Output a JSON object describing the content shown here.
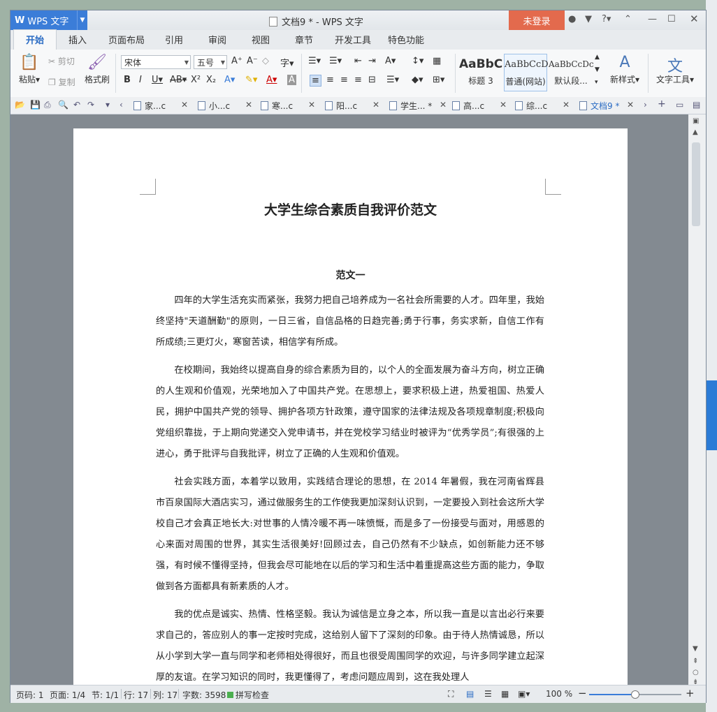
{
  "app": {
    "badge_logo": "W",
    "badge_name": "WPS 文字",
    "window_title": "文档9 * - WPS 文字",
    "login_label": "未登录"
  },
  "menu": {
    "tabs": [
      "开始",
      "插入",
      "页面布局",
      "引用",
      "审阅",
      "视图",
      "章节",
      "开发工具",
      "特色功能"
    ],
    "active": 0
  },
  "ribbon": {
    "paste": "粘贴",
    "cut": "剪切",
    "copy": "复制",
    "format_painter": "格式刷",
    "font_name": "宋体",
    "font_size": "五号",
    "styles": [
      {
        "sample": "AaBbC",
        "label": "标题 3"
      },
      {
        "sample": "AaBbCcD",
        "label": "普通(网站)"
      },
      {
        "sample": "AaBbCcDc",
        "label": "默认段..."
      }
    ],
    "new_style": "新样式",
    "text_tools": "文字工具"
  },
  "doc_tabs": [
    {
      "label": "家...c"
    },
    {
      "label": "小...c"
    },
    {
      "label": "寒...c"
    },
    {
      "label": "阳...c"
    },
    {
      "label": "学生... *"
    },
    {
      "label": "高...c"
    },
    {
      "label": "综...c"
    },
    {
      "label": "文档9 *"
    }
  ],
  "document": {
    "title": "大学生综合素质自我评价范文",
    "subtitle": "范文一",
    "paragraphs": [
      "四年的大学生活充实而紧张，我努力把自己培养成为一名社会所需要的人才。四年里，我始终坚持\"天道酬勤\"的原则，一日三省，自信品格的日趋完善;勇于行事，务实求新，自信工作有所成绩;三更灯火，寒窗苦读，相信学有所成。",
      "在校期间，我始终以提高自身的综合素质为目的，以个人的全面发展为奋斗方向，树立正确的人生观和价值观，光荣地加入了中国共产党。在思想上，要求积极上进，热爱祖国、热爱人民，拥护中国共产党的领导、拥护各项方针政策，遵守国家的法律法规及各项规章制度;积极向党组织靠拢，于上期向党递交入党申请书，并在党校学习结业时被评为“优秀学员”;有很强的上进心，勇于批评与自我批评，树立了正确的人生观和价值观。",
      "社会实践方面，本着学以致用，实践结合理论的思想，在 2014 年暑假，我在河南省辉县市百泉国际大酒店实习，通过做服务生的工作使我更加深刻认识到，一定要投入到社会这所大学校自己才会真正地长大:对世事的人情冷暖不再一味愤慨，而是多了一份接受与面对，用感恩的心来面对周围的世界，其实生活很美好!回顾过去，自己仍然有不少缺点，如创新能力还不够强，有时候不懂得坚持，但我会尽可能地在以后的学习和生活中着重提高这些方面的能力，争取做到各方面都具有新素质的人才。",
      "我的优点是诚实、热情、性格坚毅。我认为诚信是立身之本，所以我一直是以言出必行来要求自己的，答应别人的事一定按时完成，这给别人留下了深刻的印象。由于待人热情诚恳，所以从小学到大学一直与同学和老师相处得很好，而且也很受周围同学的欢迎，与许多同学建立起深厚的友谊。在学习知识的同时，我更懂得了，考虑问题应周到，这在我处理人"
    ]
  },
  "status": {
    "page_code": "页码: 1",
    "pages": "页面: 1/4",
    "section": "节: 1/1",
    "row": "行: 17",
    "col": "列: 17",
    "word_count": "字数: 3598",
    "spell_check": "拼写检查",
    "zoom": "100 %",
    "zoom_fraction": 0.5
  }
}
